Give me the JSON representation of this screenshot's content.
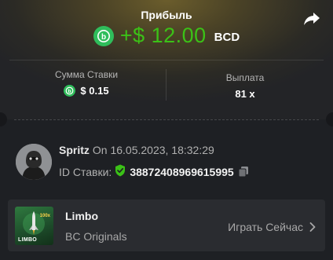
{
  "header": {
    "title": "Прибыль",
    "amount": "+$ 12.00",
    "currency": "BCD"
  },
  "stats": {
    "bet_amount_label": "Сумма Ставки",
    "bet_amount_value": "$ 0.15",
    "payout_label": "Выплата",
    "payout_value": "81 x"
  },
  "bet": {
    "username": "Spritz",
    "date_text": "On 16.05.2023, 18:32:29",
    "id_label": "ID Ставки:",
    "id_value": "38872408969615995"
  },
  "game": {
    "name": "Limbo",
    "provider": "BC Originals",
    "play_label": "Играть Сейчас",
    "thumb_label": "LIMBO",
    "thumb_multiplier": "100x"
  },
  "colors": {
    "profit": "#3bc117",
    "coin": "#2fbd5b",
    "background": "#1e2024"
  }
}
